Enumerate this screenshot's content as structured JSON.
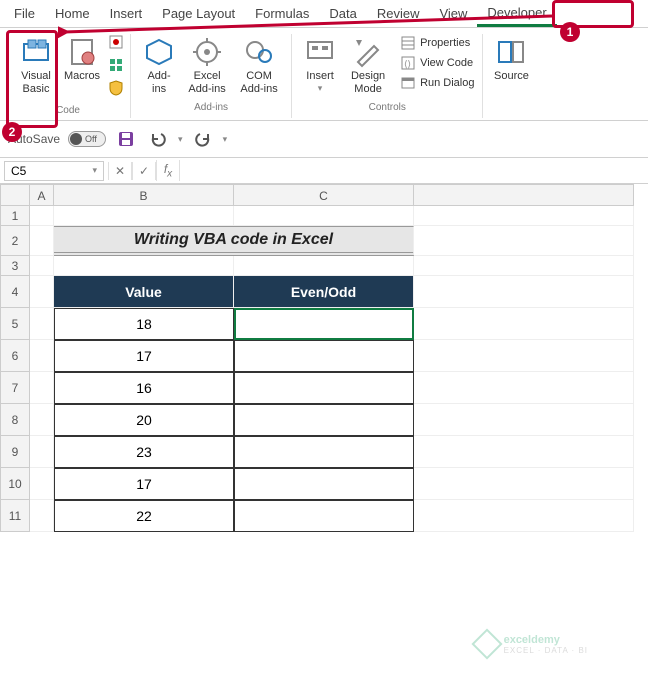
{
  "tabs": {
    "items": [
      "File",
      "Home",
      "Insert",
      "Page Layout",
      "Formulas",
      "Data",
      "Review",
      "View",
      "Developer"
    ],
    "active": "Developer"
  },
  "ribbon": {
    "code": {
      "label": "Code",
      "visual_basic": "Visual Basic",
      "macros": "Macros"
    },
    "addins": {
      "label": "Add-ins",
      "addins": "Add-ins",
      "excel_addins": "Excel Add-ins",
      "com": "COM Add-ins"
    },
    "controls": {
      "label": "Controls",
      "insert": "Insert",
      "design": "Design Mode",
      "properties": "Properties",
      "view_code": "View Code",
      "run_dialog": "Run Dialog"
    },
    "xml": {
      "label": "",
      "source": "Source"
    }
  },
  "callouts": {
    "badge1": "1",
    "badge2": "2"
  },
  "qat": {
    "autosave": "AutoSave",
    "autosave_state": "Off"
  },
  "namebox": {
    "value": "C5"
  },
  "sheet": {
    "title": "Writing VBA code in Excel",
    "headers": {
      "value": "Value",
      "evenodd": "Even/Odd"
    },
    "rows": [
      {
        "value": "18",
        "evenodd": ""
      },
      {
        "value": "17",
        "evenodd": ""
      },
      {
        "value": "16",
        "evenodd": ""
      },
      {
        "value": "20",
        "evenodd": ""
      },
      {
        "value": "23",
        "evenodd": ""
      },
      {
        "value": "17",
        "evenodd": ""
      },
      {
        "value": "22",
        "evenodd": ""
      }
    ],
    "col_labels": {
      "A": "A",
      "B": "B",
      "C": "C"
    },
    "row_labels": [
      "1",
      "2",
      "3",
      "4",
      "5",
      "6",
      "7",
      "8",
      "9",
      "10",
      "11"
    ]
  },
  "watermark": {
    "brand": "exceldemy",
    "sub": "EXCEL · DATA · BI"
  }
}
